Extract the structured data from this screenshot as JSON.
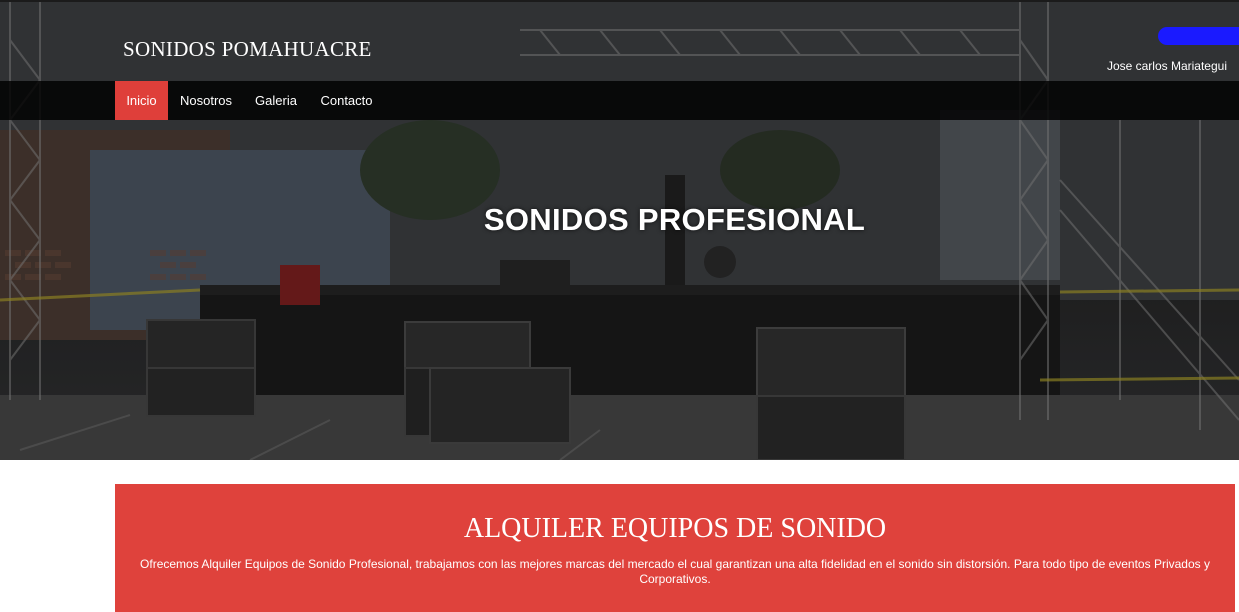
{
  "header": {
    "brand": "SONIDOS POMAHUACRE",
    "user_name": "Jose carlos Mariategui"
  },
  "nav": {
    "items": [
      {
        "label": "Inicio",
        "active": true
      },
      {
        "label": "Nosotros",
        "active": false
      },
      {
        "label": "Galeria",
        "active": false
      },
      {
        "label": "Contacto",
        "active": false
      }
    ]
  },
  "hero": {
    "title": "SONIDOS PROFESIONAL"
  },
  "promo": {
    "title": "ALQUILER EQUIPOS DE SONIDO",
    "text": "Ofrecemos Alquiler Equipos de Sonido Profesional, trabajamos con las mejores marcas del mercado el cual garantizan una alta fidelidad en el sonido sin distorsión. Para todo tipo de eventos Privados y Corporativos."
  },
  "colors": {
    "accent_red": "#df423c",
    "nav_active": "#df3f3a",
    "user_badge": "#1a1aff"
  }
}
